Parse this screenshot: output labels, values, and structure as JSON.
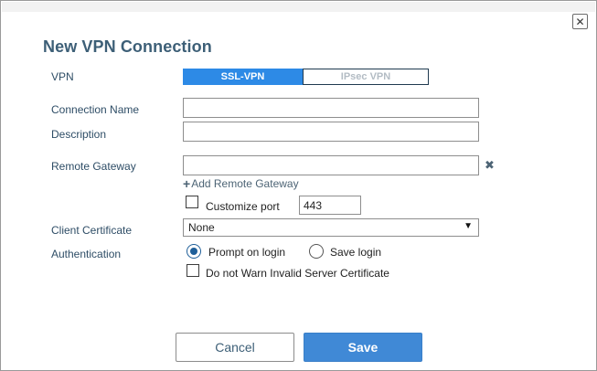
{
  "dialog": {
    "title": "New VPN Connection",
    "close_icon": "close-icon"
  },
  "form": {
    "vpn_label": "VPN",
    "vpn_options": [
      "SSL-VPN",
      "IPsec VPN"
    ],
    "vpn_selected": "SSL-VPN",
    "connection_name_label": "Connection Name",
    "connection_name_value": "",
    "description_label": "Description",
    "description_value": "",
    "remote_gateway_label": "Remote Gateway",
    "remote_gateway_value": "",
    "add_remote_gateway": "Add Remote Gateway",
    "customize_port_label": "Customize port",
    "customize_port_checked": false,
    "port_value": "443",
    "client_certificate_label": "Client Certificate",
    "client_certificate_value": "None",
    "authentication_label": "Authentication",
    "auth_options": [
      "Prompt on login",
      "Save login"
    ],
    "auth_selected": "Prompt on login",
    "warn_label": "Do not Warn Invalid Server Certificate",
    "warn_checked": false
  },
  "buttons": {
    "cancel": "Cancel",
    "save": "Save"
  },
  "colors": {
    "accent": "#2d8ae6",
    "save_button": "#4089d6",
    "title": "#3d5f77"
  }
}
